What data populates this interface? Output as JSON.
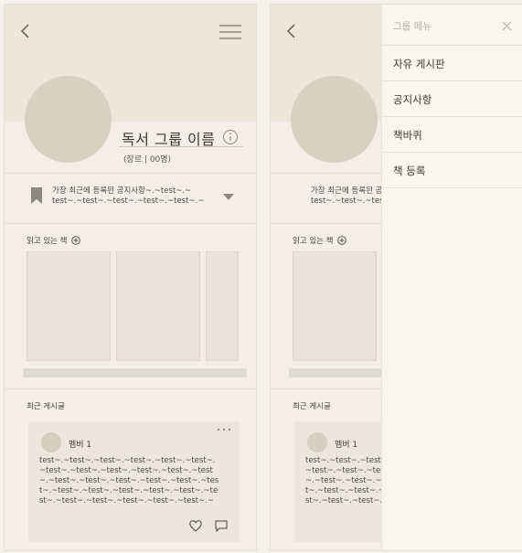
{
  "group": {
    "name": "독서 그룹 이름",
    "meta": "(장르 | 00명)"
  },
  "notice": {
    "line1": "가장 최근에 등록된 공지사항~.~test~.~",
    "line2": "test~.~test~.~test~.~test~.~test~.~"
  },
  "reading": {
    "title": "읽고 있는 책"
  },
  "recent": {
    "title": "최근 게시글"
  },
  "post": {
    "member": "멤버 1",
    "lines": [
      "test~.~test~.~test~.~test~.~test~.~test~.",
      "~test~.~test~.~test~.~test~.~test~.~test",
      "~.~test~.~test~.~test~.~test~.~test~.~tes",
      "t~.~test~.~test~.~test~.~test~.~test~.~te",
      "st~.~test~.~test~.~test~.~test~.~test~.~"
    ]
  },
  "drawer": {
    "title": "그룹 메뉴",
    "items": [
      {
        "label": "자유 게시판"
      },
      {
        "label": "공지사항"
      },
      {
        "label": "책바퀴"
      },
      {
        "label": "책 등록"
      }
    ]
  },
  "colors": {
    "background": "#f3efe6",
    "header": "#ede7da",
    "placeholder": "#d9d0c1",
    "card": "#e9e4d9",
    "drawer": "#f9f6f0",
    "text": "#3f3a33",
    "muted": "#b7b0a4"
  },
  "icons": {
    "back": "back-arrow-icon",
    "menu": "hamburger-menu-icon",
    "info": "info-icon",
    "bookmark": "bookmark-icon",
    "dropdown": "caret-down-icon",
    "add": "plus-circle-icon",
    "more": "more-horizontal-icon",
    "like": "heart-icon",
    "comment": "comment-icon",
    "close": "close-icon"
  }
}
